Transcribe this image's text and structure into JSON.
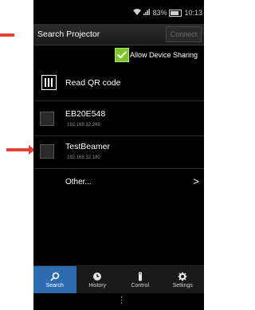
{
  "status_bar": {
    "battery_percent": "83%",
    "time": "10:13"
  },
  "header": {
    "title": "Search Projector",
    "connect_label": "Connect"
  },
  "sharing": {
    "label": "Allow Device Sharing",
    "checked": true
  },
  "qr": {
    "label": "Read QR code"
  },
  "devices": [
    {
      "name": "EB20E548",
      "ip": "192.168.32.248"
    },
    {
      "name": "TestBeamer",
      "ip": "192.168.32.180"
    }
  ],
  "other": {
    "label": "Other...",
    "chevron": ">"
  },
  "tabs": [
    {
      "label": "Search",
      "icon": "search-icon"
    },
    {
      "label": "History",
      "icon": "clock-icon"
    },
    {
      "label": "Control",
      "icon": "remote-icon"
    },
    {
      "label": "Settings",
      "icon": "gear-icon"
    }
  ],
  "nav": {
    "overflow": "⋮"
  },
  "colors": {
    "active_tab": "#2b6db0",
    "checkbox_green": "#7cc62b",
    "arrow_red": "#e5413b"
  }
}
